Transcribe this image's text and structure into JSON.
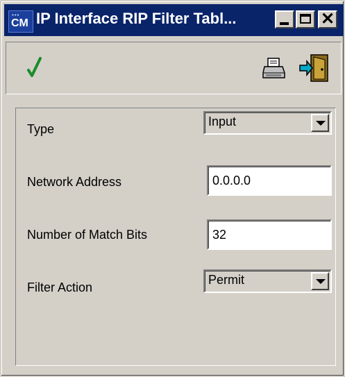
{
  "window": {
    "title": "IP Interface RIP Filter Tabl...",
    "icon_text": "CM",
    "icon_small_text": "▪▪▪"
  },
  "titlebar_buttons": [
    {
      "name": "minimize",
      "icon": "minimize-icon"
    },
    {
      "name": "maximize",
      "icon": "maximize-icon"
    },
    {
      "name": "close",
      "icon": "close-icon"
    }
  ],
  "toolbar": {
    "apply_icon": "checkmark-icon",
    "print_icon": "printer-icon",
    "exit_icon": "exit-door-icon",
    "check_color": "#1a8c2a"
  },
  "form": {
    "type_label": "Type",
    "type_value": "Input",
    "network_label": "Network Address",
    "network_value": "0.0.0.0",
    "bits_label": "Number of Match Bits",
    "bits_value": "32",
    "action_label": "Filter Action",
    "action_value": "Permit"
  },
  "colors": {
    "titlebar": "#0a246a",
    "face": "#d4d0c8"
  }
}
